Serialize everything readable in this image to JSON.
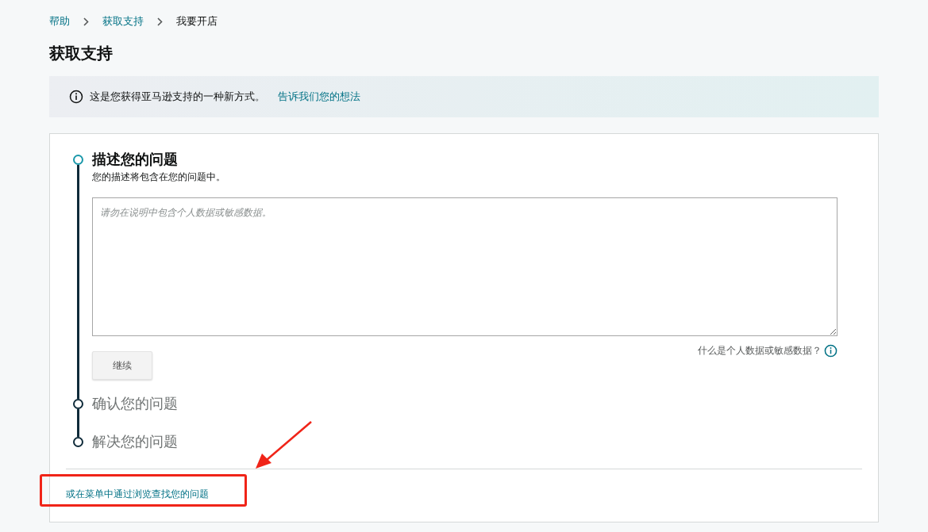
{
  "breadcrumb": [
    {
      "label": "帮助",
      "link": true
    },
    {
      "label": "获取支持",
      "link": true
    },
    {
      "label": "我要开店",
      "link": false
    }
  ],
  "title": "获取支持",
  "banner": {
    "text": "这是您获得亚马逊支持的一种新方式。",
    "link": "告诉我们您的想法"
  },
  "steps": [
    {
      "title": "描述您的问题",
      "active": true,
      "description": "您的描述将包含在您的问题中。",
      "placeholder": "请勿在说明中包含个人数据或敏感数据。",
      "hint": "什么是个人数据或敏感数据？",
      "button": "继续"
    },
    {
      "title": "确认您的问题",
      "active": false
    },
    {
      "title": "解决您的问题",
      "active": false
    }
  ],
  "browse_link": "或在菜单中通过浏览查找您的问题",
  "annotations": {
    "arrow": true,
    "highlight_frame": true
  }
}
